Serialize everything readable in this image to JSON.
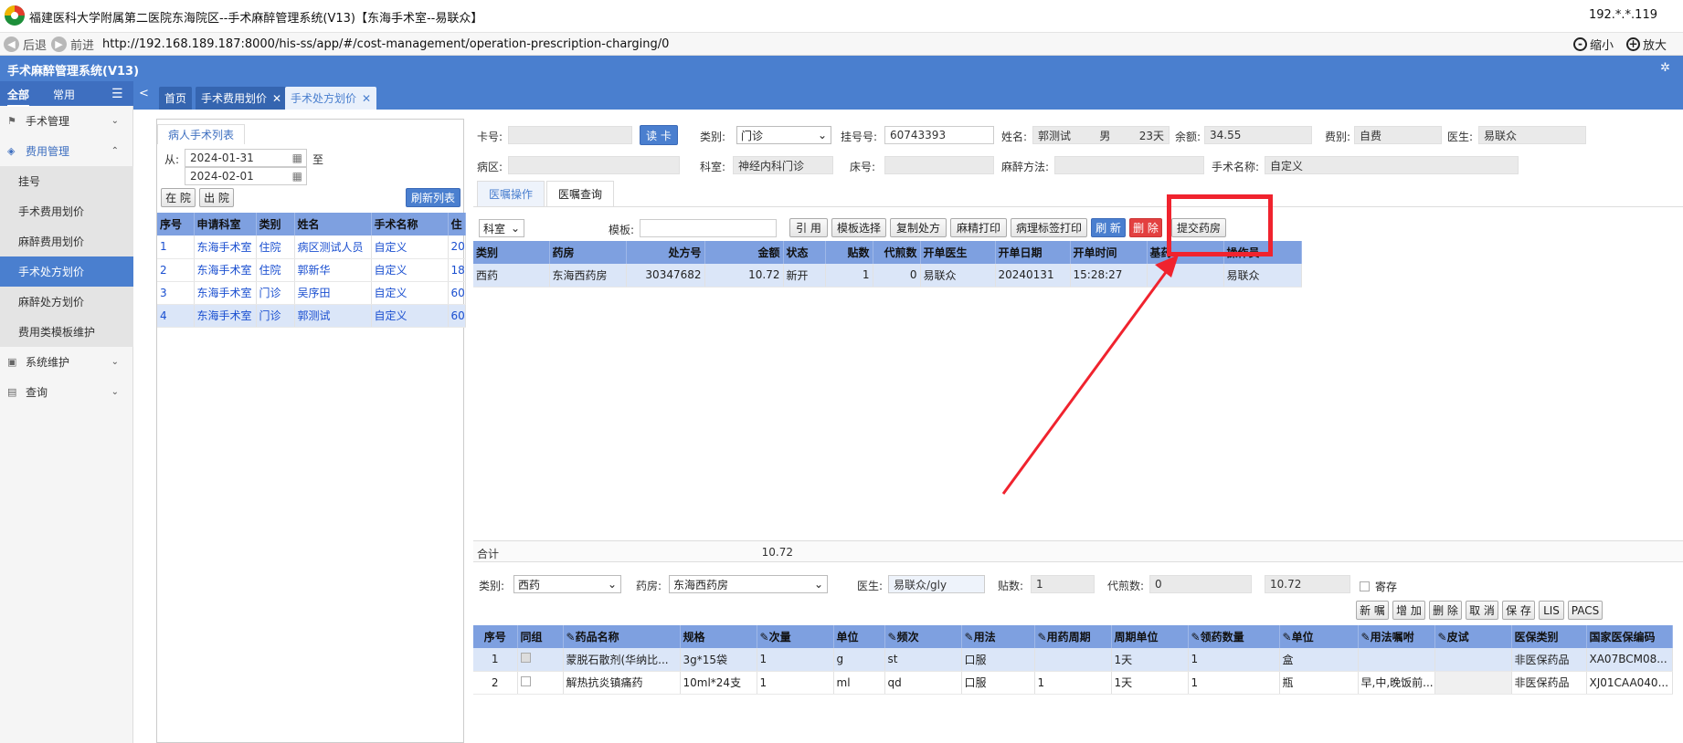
{
  "window": {
    "title": "福建医科大学附属第二医院东海院区--手术麻醉管理系统(V13)【东海手术室--易联众】",
    "ip": "192.*.*.119"
  },
  "nav": {
    "back": "后退",
    "forward": "前进",
    "url": "http://192.168.189.187:8000/his-ss/app/#/cost-management/operation-prescription-charging/0",
    "zoom_out": "缩小",
    "zoom_in": "放大"
  },
  "app": {
    "name": "手术麻醉管理系统(V13)"
  },
  "sidebar": {
    "tab_all": "全部",
    "tab_common": "常用",
    "menus": [
      {
        "label": "手术管理"
      },
      {
        "label": "费用管理"
      },
      {
        "label": "系统维护"
      },
      {
        "label": "查询"
      }
    ],
    "subitems": [
      "挂号",
      "手术费用划价",
      "麻醉费用划价",
      "手术处方划价",
      "麻醉处方划价",
      "费用类模板维护"
    ]
  },
  "tabs": [
    "首页",
    "手术费用划价",
    "手术处方划价"
  ],
  "left": {
    "panel_title": "病人手术列表",
    "from_label": "从:",
    "to_label": "至",
    "date_from": "2024-01-31",
    "date_to": "2024-02-01",
    "btn_in": "在 院",
    "btn_out": "出 院",
    "btn_refresh": "刷新列表",
    "headers": [
      "序号",
      "申请科室",
      "类别",
      "姓名",
      "手术名称",
      "住"
    ],
    "rows": [
      [
        "1",
        "东海手术室",
        "住院",
        "病区测试人员",
        "自定义",
        "20"
      ],
      [
        "2",
        "东海手术室",
        "住院",
        "郭新华",
        "自定义",
        "18"
      ],
      [
        "3",
        "东海手术室",
        "门诊",
        "吴序田",
        "自定义",
        "60"
      ],
      [
        "4",
        "东海手术室",
        "门诊",
        "郭测试",
        "自定义",
        "60"
      ]
    ]
  },
  "form": {
    "card_label": "卡号:",
    "read_card": "读 卡",
    "type_label": "类别:",
    "type_value": "门诊",
    "reg_label": "挂号号:",
    "reg_value": "60743393",
    "name_label": "姓名:",
    "name_value": "郭测试",
    "sex_value": "男",
    "age_value": "23天",
    "balance_label": "余额:",
    "balance_value": "34.55",
    "fee_label": "费别:",
    "fee_value": "自费",
    "doctor_label": "医生:",
    "doctor_value": "易联众",
    "ward_label": "病区:",
    "dept_label": "科室:",
    "dept_value": "神经内科门诊",
    "bed_label": "床号:",
    "anes_label": "麻醉方法:",
    "op_label": "手术名称:",
    "op_value": "自定义"
  },
  "subtabs": [
    "医嘱操作",
    "医嘱查询"
  ],
  "toolbar": {
    "dept_select": "科室",
    "template_label": "模板:",
    "buttons": [
      "引 用",
      "模板选择",
      "复制处方",
      "麻精打印",
      "病理标签打印"
    ],
    "refresh": "刷 新",
    "delete": "删 除",
    "submit": "提交药房"
  },
  "rx_table": {
    "headers": [
      "类别",
      "药房",
      "处方号",
      "金额",
      "状态",
      "贴数",
      "代煎数",
      "开单医生",
      "开单日期",
      "开单时间",
      "基药",
      "操作员"
    ],
    "rows": [
      [
        "西药",
        "东海西药房",
        "30347682",
        "10.72",
        "新开",
        "1",
        "0",
        "易联众",
        "20240131",
        "15:28:27",
        "",
        "易联众"
      ]
    ],
    "total_label": "合计",
    "total_value": "10.72"
  },
  "detail": {
    "type_label": "类别:",
    "type_value": "西药",
    "pharmacy_label": "药房:",
    "pharmacy_value": "东海西药房",
    "doctor_label": "医生:",
    "doctor_value": "易联众/gly",
    "patch_label": "贴数:",
    "patch_value": "1",
    "decoct_label": "代煎数:",
    "decoct_value": "0",
    "amount_value": "10.72",
    "deposit_label": "寄存",
    "buttons": [
      "新 嘱",
      "增 加",
      "删 除",
      "取 消",
      "保 存",
      "LIS",
      "PACS"
    ]
  },
  "drug_table": {
    "headers": [
      "序号",
      "同组",
      "药品名称",
      "规格",
      "次量",
      "单位",
      "频次",
      "用法",
      "用药周期",
      "周期单位",
      "领药数量",
      "单位",
      "用法嘱咐",
      "皮试",
      "医保类别",
      "国家医保编码"
    ],
    "rows": [
      [
        "1",
        "",
        "蒙脱石散剂(华纳比...",
        "3g*15袋",
        "1",
        "g",
        "st",
        "口服",
        "",
        "1天",
        "1",
        "盒",
        "",
        "",
        "非医保药品",
        "XA07BCM08..."
      ],
      [
        "2",
        "",
        "解热抗炎镇痛药",
        "10ml*24支",
        "1",
        "ml",
        "qd",
        "口服",
        "1",
        "1天",
        "1",
        "瓶",
        "早,中,晚饭前...",
        "",
        "非医保药品",
        "XJ01CAA040..."
      ]
    ]
  },
  "colors": {
    "accent": "#4a7fcf",
    "highlight": "#f0232e",
    "header": "#7ea0e0"
  }
}
